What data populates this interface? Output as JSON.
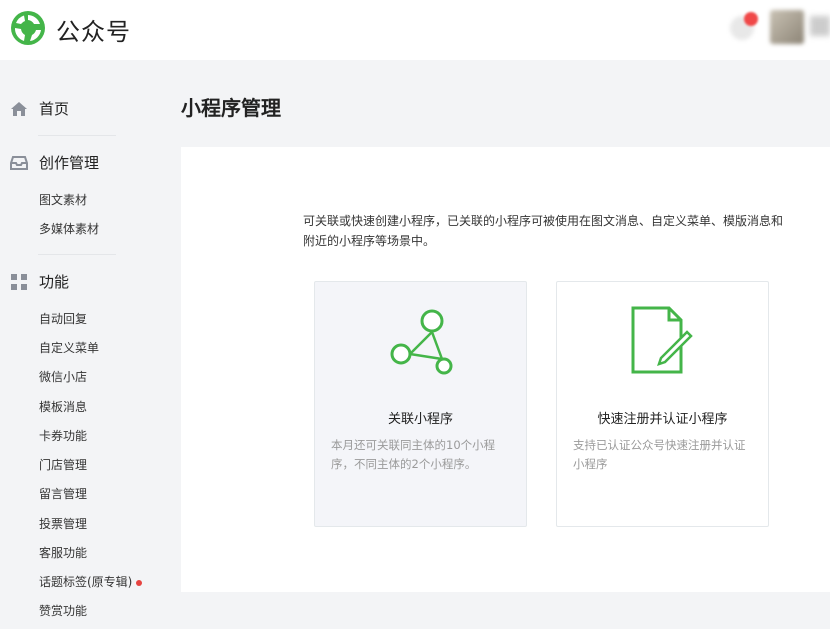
{
  "header": {
    "brand": "公众号"
  },
  "sidebar": {
    "home": "首页",
    "creation": {
      "label": "创作管理",
      "items": [
        "图文素材",
        "多媒体素材"
      ]
    },
    "features": {
      "label": "功能",
      "items": [
        "自动回复",
        "自定义菜单",
        "微信小店",
        "模板消息",
        "卡券功能",
        "门店管理",
        "留言管理",
        "投票管理",
        "客服功能",
        "话题标签(原专辑)",
        "赞赏功能"
      ]
    }
  },
  "main": {
    "title": "小程序管理",
    "description": "可关联或快速创建小程序，已关联的小程序可被使用在图文消息、自定义菜单、模版消息和附近的小程序等场景中。",
    "cards": [
      {
        "title": "关联小程序",
        "desc": "本月还可关联同主体的10个小程序，不同主体的2个小程序。",
        "icon": "share-nodes-icon"
      },
      {
        "title": "快速注册并认证小程序",
        "desc": "支持已认证公众号快速注册并认证小程序",
        "icon": "document-edit-icon"
      }
    ]
  },
  "colors": {
    "accent_green": "#44b549",
    "badge_red": "#e64340"
  }
}
